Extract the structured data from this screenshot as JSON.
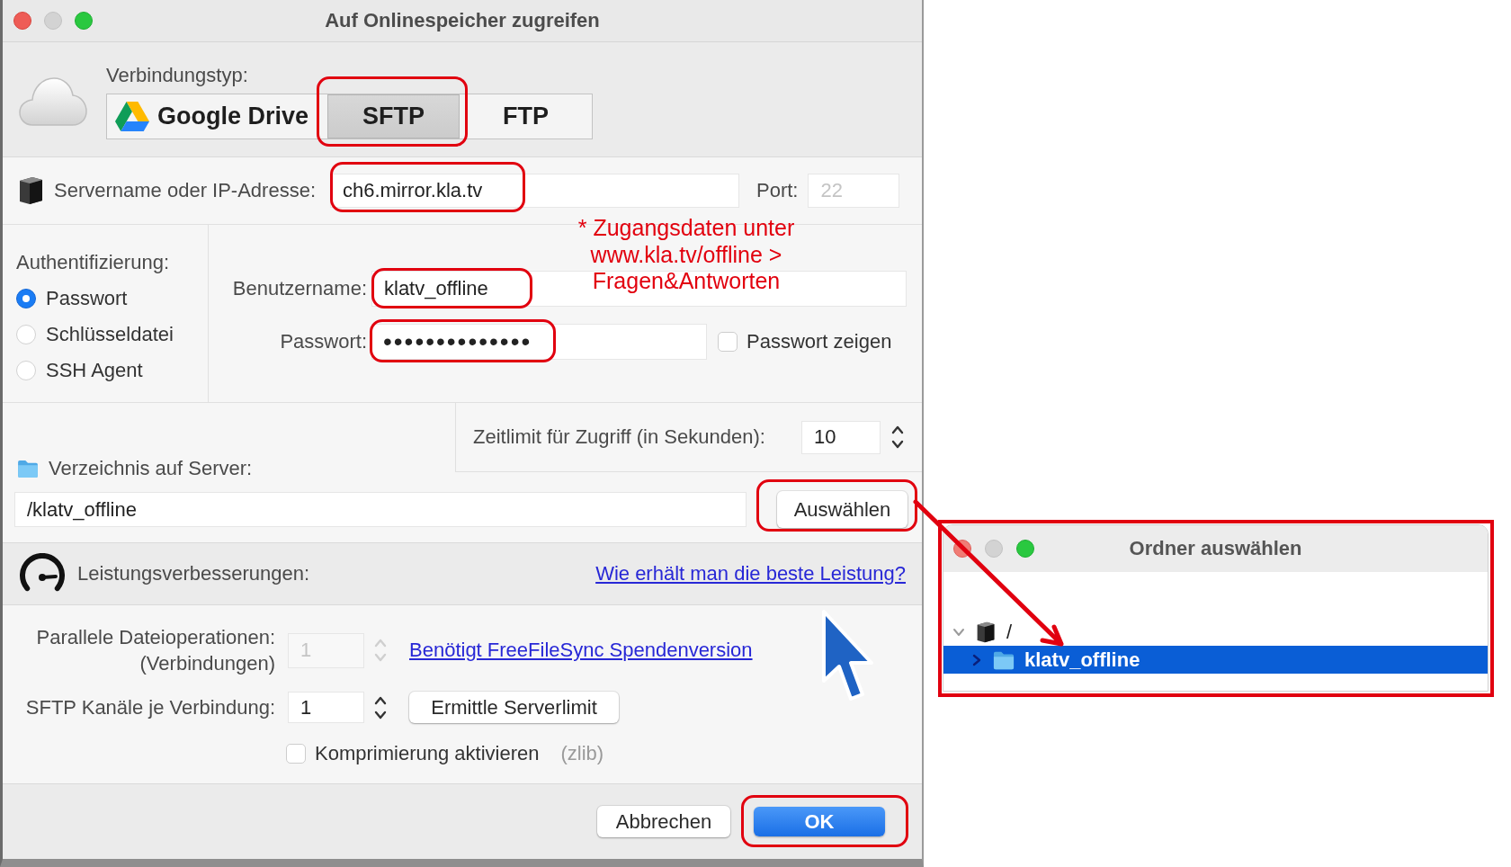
{
  "window": {
    "title": "Auf Onlinespeicher zugreifen"
  },
  "connection_type": {
    "label": "Verbindungstyp:",
    "options": [
      {
        "label": "Google Drive",
        "kind": "drive",
        "selected": false,
        "highlighted": false
      },
      {
        "label": "SFTP",
        "kind": "plain",
        "selected": true,
        "highlighted": true
      },
      {
        "label": "FTP",
        "kind": "plain",
        "selected": false,
        "highlighted": false
      }
    ]
  },
  "server": {
    "label": "Servername oder IP-Adresse:",
    "value": "ch6.mirror.kla.tv",
    "highlighted": true
  },
  "port": {
    "label": "Port:",
    "placeholder": "22"
  },
  "note": {
    "lines": [
      "* Zugangsdaten unter",
      "www.kla.tv/offline >",
      "Fragen&Antworten"
    ]
  },
  "authentication": {
    "label": "Authentifizierung:",
    "options": [
      {
        "label": "Passwort",
        "selected": true
      },
      {
        "label": "Schlüsseldatei",
        "selected": false
      },
      {
        "label": "SSH Agent",
        "selected": false
      }
    ]
  },
  "username": {
    "label": "Benutzername:",
    "value": "klatv_offline",
    "highlighted": true
  },
  "password": {
    "label": "Passwort:",
    "value": "••••••••••••••",
    "highlighted": true
  },
  "show_password": {
    "label": "Passwort zeigen",
    "checked": false
  },
  "timeout": {
    "label": "Zeitlimit für Zugriff (in Sekunden):",
    "value": "10"
  },
  "directory": {
    "label": "Verzeichnis auf Server:",
    "value": "/klatv_offline",
    "button": {
      "label": "Auswählen",
      "highlighted": true
    }
  },
  "performance": {
    "label": "Leistungsverbesserungen:",
    "link": "Wie erhält man die beste Leistung?"
  },
  "parallel_operations": {
    "label_lines": [
      "Parallele Dateioperationen:",
      "(Verbindungen)"
    ],
    "value": "1",
    "disabled": true,
    "link": "Benötigt FreeFileSync Spendenversion"
  },
  "sftp_channels": {
    "label": "SFTP Kanäle je Verbindung:",
    "value": "1",
    "button": "Ermittle Serverlimit"
  },
  "compression": {
    "label": "Komprimierung aktivieren",
    "checked": false,
    "hint": "(zlib)"
  },
  "buttons": [
    {
      "label": "Abbrechen",
      "kind": "secondary",
      "highlighted": false
    },
    {
      "label": "OK",
      "kind": "primary",
      "highlighted": true
    }
  ],
  "folder_dialog": {
    "title": "Ordner auswählen",
    "highlighted": true,
    "tree": [
      {
        "label": "/",
        "kind": "server",
        "expanded": true,
        "selected": false,
        "children": [
          {
            "label": "klatv_offline",
            "kind": "folder",
            "expanded": false,
            "selected": true
          }
        ]
      }
    ]
  }
}
